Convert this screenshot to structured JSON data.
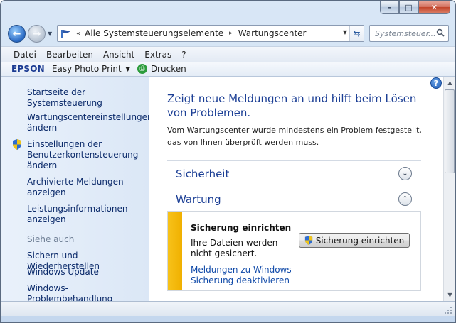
{
  "window": {
    "caption_buttons": {
      "minimize": "–",
      "maximize": "□",
      "close": "✕"
    }
  },
  "nav": {
    "back_icon": "back-arrow-icon",
    "forward_icon": "forward-arrow-icon",
    "address_separator": "«",
    "breadcrumb": [
      "Alle Systemsteuerungselemente",
      "Wartungscenter"
    ],
    "breadcrumb_arrow": "▸",
    "search_placeholder": "Systemsteuer..."
  },
  "menu": {
    "items": [
      "Datei",
      "Bearbeiten",
      "Ansicht",
      "Extras",
      "?"
    ]
  },
  "epson": {
    "logo": "EPSON",
    "app": "Easy Photo Print",
    "print": "Drucken"
  },
  "sidebar": {
    "links": [
      "Startseite der Systemsteuerung",
      "Wartungscentereinstellungen ändern",
      "Einstellungen der Benutzerkontensteuerung ändern",
      "Archivierte Meldungen anzeigen",
      "Leistungsinformationen anzeigen"
    ],
    "see_also_heading": "Siehe auch",
    "see_also": [
      "Sichern und Wiederherstellen",
      "Windows Update",
      "Windows-Problembehandlung"
    ]
  },
  "main": {
    "help": "?",
    "title": "Zeigt neue Meldungen an und hilft beim Lösen von Problemen.",
    "description": "Vom Wartungscenter wurde mindestens ein Problem festgestellt, das von Ihnen überprüft werden muss.",
    "sections": [
      {
        "title": "Sicherheit",
        "expanded": false
      },
      {
        "title": "Wartung",
        "expanded": true
      }
    ],
    "wartung_item": {
      "title": "Sicherung einrichten",
      "text": "Ihre Dateien werden nicht gesichert.",
      "button": "Sicherung einrichten",
      "link": "Meldungen zu Windows-Sicherung deaktivieren",
      "severity_color": "#f5b800"
    }
  },
  "colors": {
    "link": "#0b2a6a",
    "title": "#1c3f95",
    "sidebar_bg": "#e3ecf8"
  }
}
